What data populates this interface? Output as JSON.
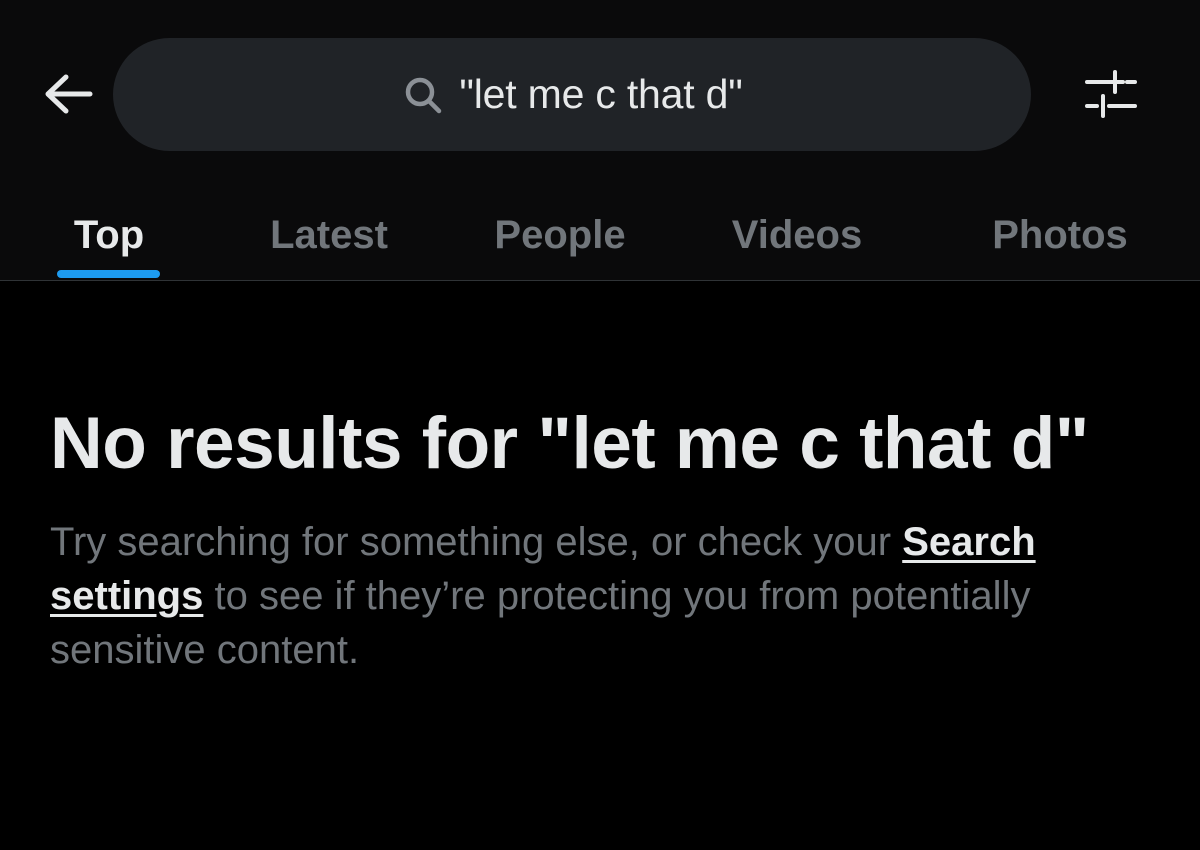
{
  "search": {
    "query": "\"let me c that d\""
  },
  "tabs": [
    {
      "label": "Top",
      "active": true
    },
    {
      "label": "Latest",
      "active": false
    },
    {
      "label": "People",
      "active": false
    },
    {
      "label": "Videos",
      "active": false
    },
    {
      "label": "Photos",
      "active": false
    }
  ],
  "empty_state": {
    "title": "No results for \"let me c that d\"",
    "desc_before": "Try searching for something else, or check your ",
    "link_label": "Search settings",
    "desc_after": " to see if they’re protecting you from potentially sensitive content."
  },
  "icons": {
    "back": "arrow-left-icon",
    "search": "search-icon",
    "filter": "sliders-icon"
  },
  "colors": {
    "background": "#000000",
    "surface": "#0a0a0b",
    "search_pill": "#202327",
    "text_primary": "#e7e9ea",
    "text_secondary": "#71767b",
    "accent": "#1d9bf0",
    "divider": "#2f3336"
  }
}
